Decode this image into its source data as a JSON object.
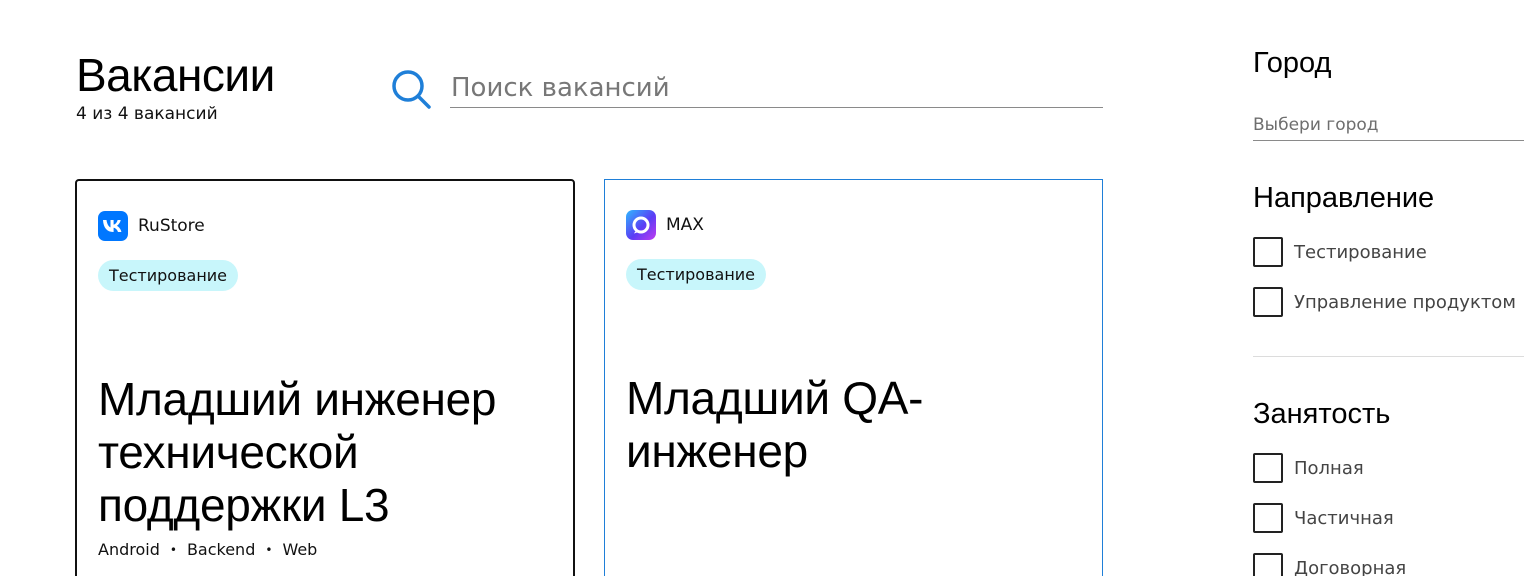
{
  "header": {
    "title": "Вакансии",
    "count_text": "4 из 4 вакансий"
  },
  "search": {
    "placeholder": "Поиск вакансий",
    "value": ""
  },
  "vacancies": [
    {
      "company": "RuStore",
      "company_logo": "vk-logo",
      "logo_color": "#0077ff",
      "tag": "Тестирование",
      "title": "Младший инженер технической поддержки L3",
      "platforms": [
        "Android",
        "Backend",
        "Web"
      ]
    },
    {
      "company": "MAX",
      "company_logo": "max-logo",
      "logo_color": "#5b3df5",
      "tag": "Тестирование",
      "title": "Младший QA-инженер",
      "platforms": []
    }
  ],
  "filters": {
    "city": {
      "heading": "Город",
      "placeholder": "Выбери город"
    },
    "direction": {
      "heading": "Направление",
      "options": [
        {
          "label": "Тестирование",
          "checked": false
        },
        {
          "label": "Управление продуктом",
          "checked": false
        }
      ]
    },
    "employment": {
      "heading": "Занятость",
      "options": [
        {
          "label": "Полная",
          "checked": false
        },
        {
          "label": "Частичная",
          "checked": false
        },
        {
          "label": "Договорная",
          "checked": false
        }
      ]
    }
  },
  "colors": {
    "accent": "#1f7fd8",
    "tag_bg": "#c8f6fb"
  }
}
